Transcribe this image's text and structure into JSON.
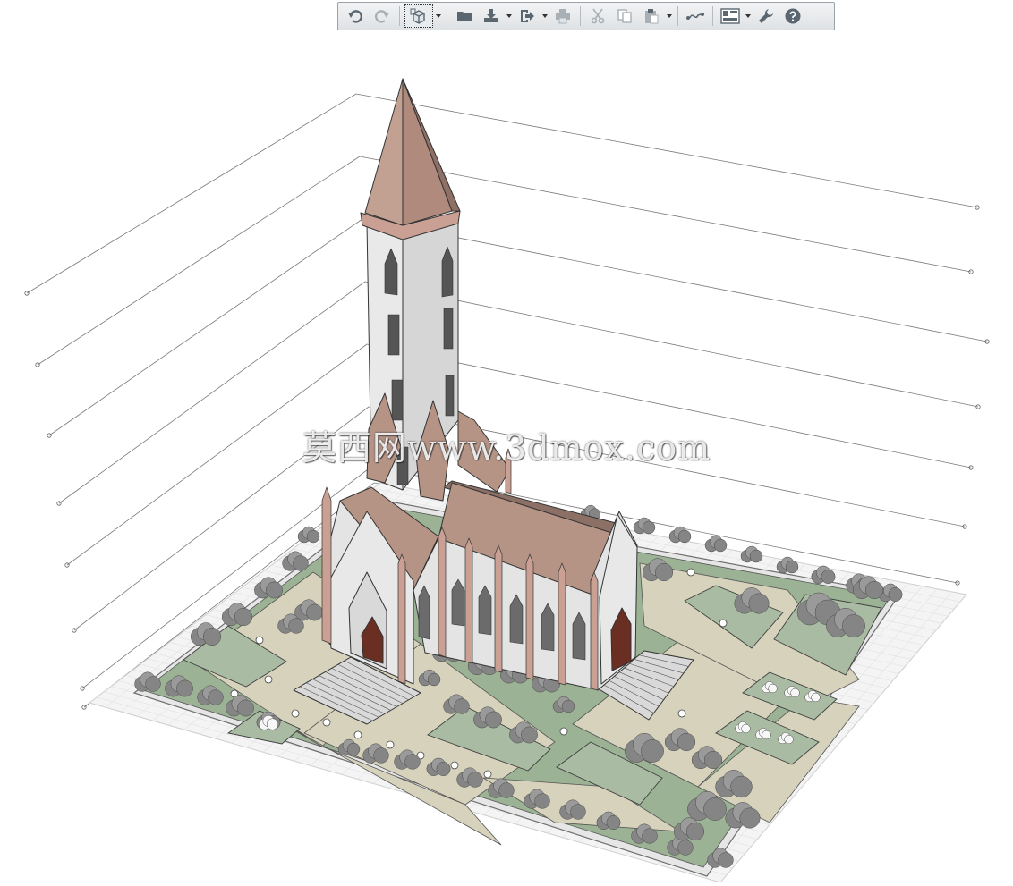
{
  "toolbar": {
    "buttons": [
      {
        "id": "undo",
        "icon": "undo-icon",
        "disabled": false
      },
      {
        "id": "redo",
        "icon": "redo-icon",
        "disabled": true
      },
      {
        "id": "view-3d",
        "icon": "3d-cube-icon",
        "active": true,
        "dropdown": true
      },
      {
        "id": "open",
        "icon": "folder-icon"
      },
      {
        "id": "import",
        "icon": "import-icon",
        "dropdown": true
      },
      {
        "id": "export",
        "icon": "export-icon",
        "dropdown": true
      },
      {
        "id": "print",
        "icon": "printer-icon"
      },
      {
        "id": "cut",
        "icon": "scissors-icon",
        "disabled": true
      },
      {
        "id": "copy",
        "icon": "copy-icon",
        "disabled": true
      },
      {
        "id": "paste",
        "icon": "clipboard-icon",
        "dropdown": true
      },
      {
        "id": "share",
        "icon": "share-link-icon"
      },
      {
        "id": "layout",
        "icon": "layout-panels-icon",
        "dropdown": true
      },
      {
        "id": "settings",
        "icon": "wrench-icon"
      },
      {
        "id": "help",
        "icon": "help-circle-icon"
      }
    ],
    "colors": {
      "icon": "#5b6770",
      "disabled": "#a8b0b6",
      "help": "#5b6770"
    }
  },
  "watermark": {
    "text": "莫西网www.3dmox.com"
  },
  "model": {
    "name": "gothic church with landscaped grounds",
    "colors": {
      "roof": "#b59486",
      "wall": "#e4e4e4",
      "trim": "#c9a093",
      "lawn": "#9bb294",
      "paving": "#d6d2bc",
      "tree": "#8f8f8f",
      "grid": "#dcdcdc"
    }
  }
}
